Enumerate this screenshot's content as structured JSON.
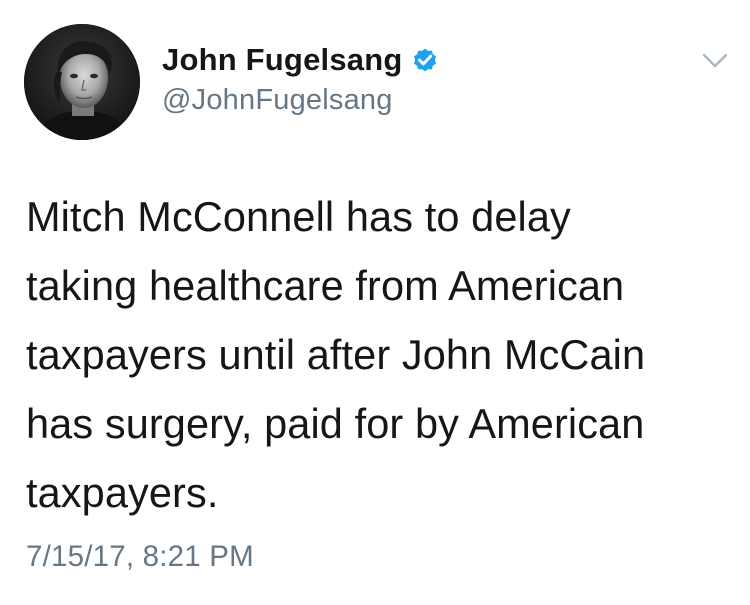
{
  "tweet": {
    "author": {
      "display_name": "John Fugelsang",
      "handle": "@JohnFugelsang",
      "verified": true,
      "verified_icon": "verified-badge-icon",
      "avatar_icon": "profile-photo"
    },
    "menu_icon": "chevron-down-icon",
    "body_lines": [
      "Mitch McConnell has to delay",
      "taking healthcare from American",
      "taxpayers until after John McCain",
      "has surgery, paid for by American",
      "taxpayers."
    ],
    "timestamp": "7/15/17, 8:21 PM"
  },
  "colors": {
    "text_primary": "#14171a",
    "text_secondary": "#657786",
    "verified_blue": "#1da1f2",
    "chevron": "#aab8c2"
  }
}
